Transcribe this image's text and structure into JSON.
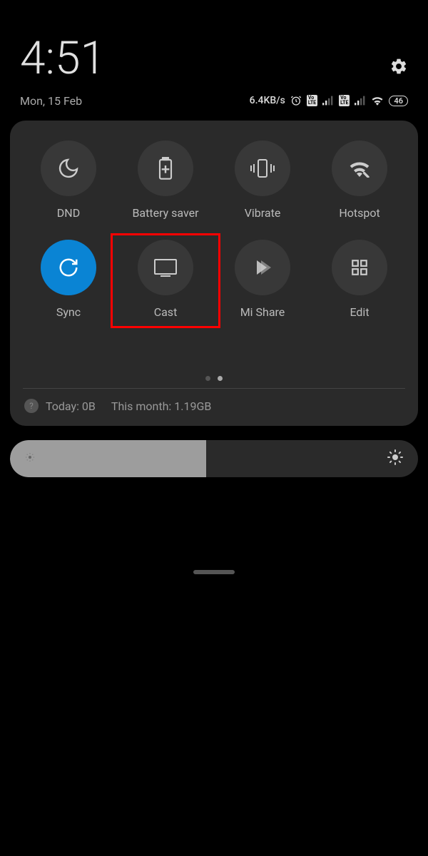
{
  "header": {
    "time": "4:51",
    "date": "Mon, 15 Feb"
  },
  "status": {
    "speed": "6.4KB/s",
    "battery": "46"
  },
  "tiles": [
    {
      "label": "DND",
      "icon": "moon",
      "active": false
    },
    {
      "label": "Battery saver",
      "icon": "battery-plus",
      "active": false
    },
    {
      "label": "Vibrate",
      "icon": "vibrate",
      "active": false
    },
    {
      "label": "Hotspot",
      "icon": "hotspot",
      "active": false
    },
    {
      "label": "Sync",
      "icon": "sync",
      "active": true
    },
    {
      "label": "Cast",
      "icon": "cast",
      "active": false,
      "highlighted": true
    },
    {
      "label": "Mi Share",
      "icon": "mishare",
      "active": false
    },
    {
      "label": "Edit",
      "icon": "grid",
      "active": false
    }
  ],
  "usage": {
    "today_label": "Today: 0B",
    "month_label": "This month: 1.19GB"
  },
  "brightness_percent": 48
}
